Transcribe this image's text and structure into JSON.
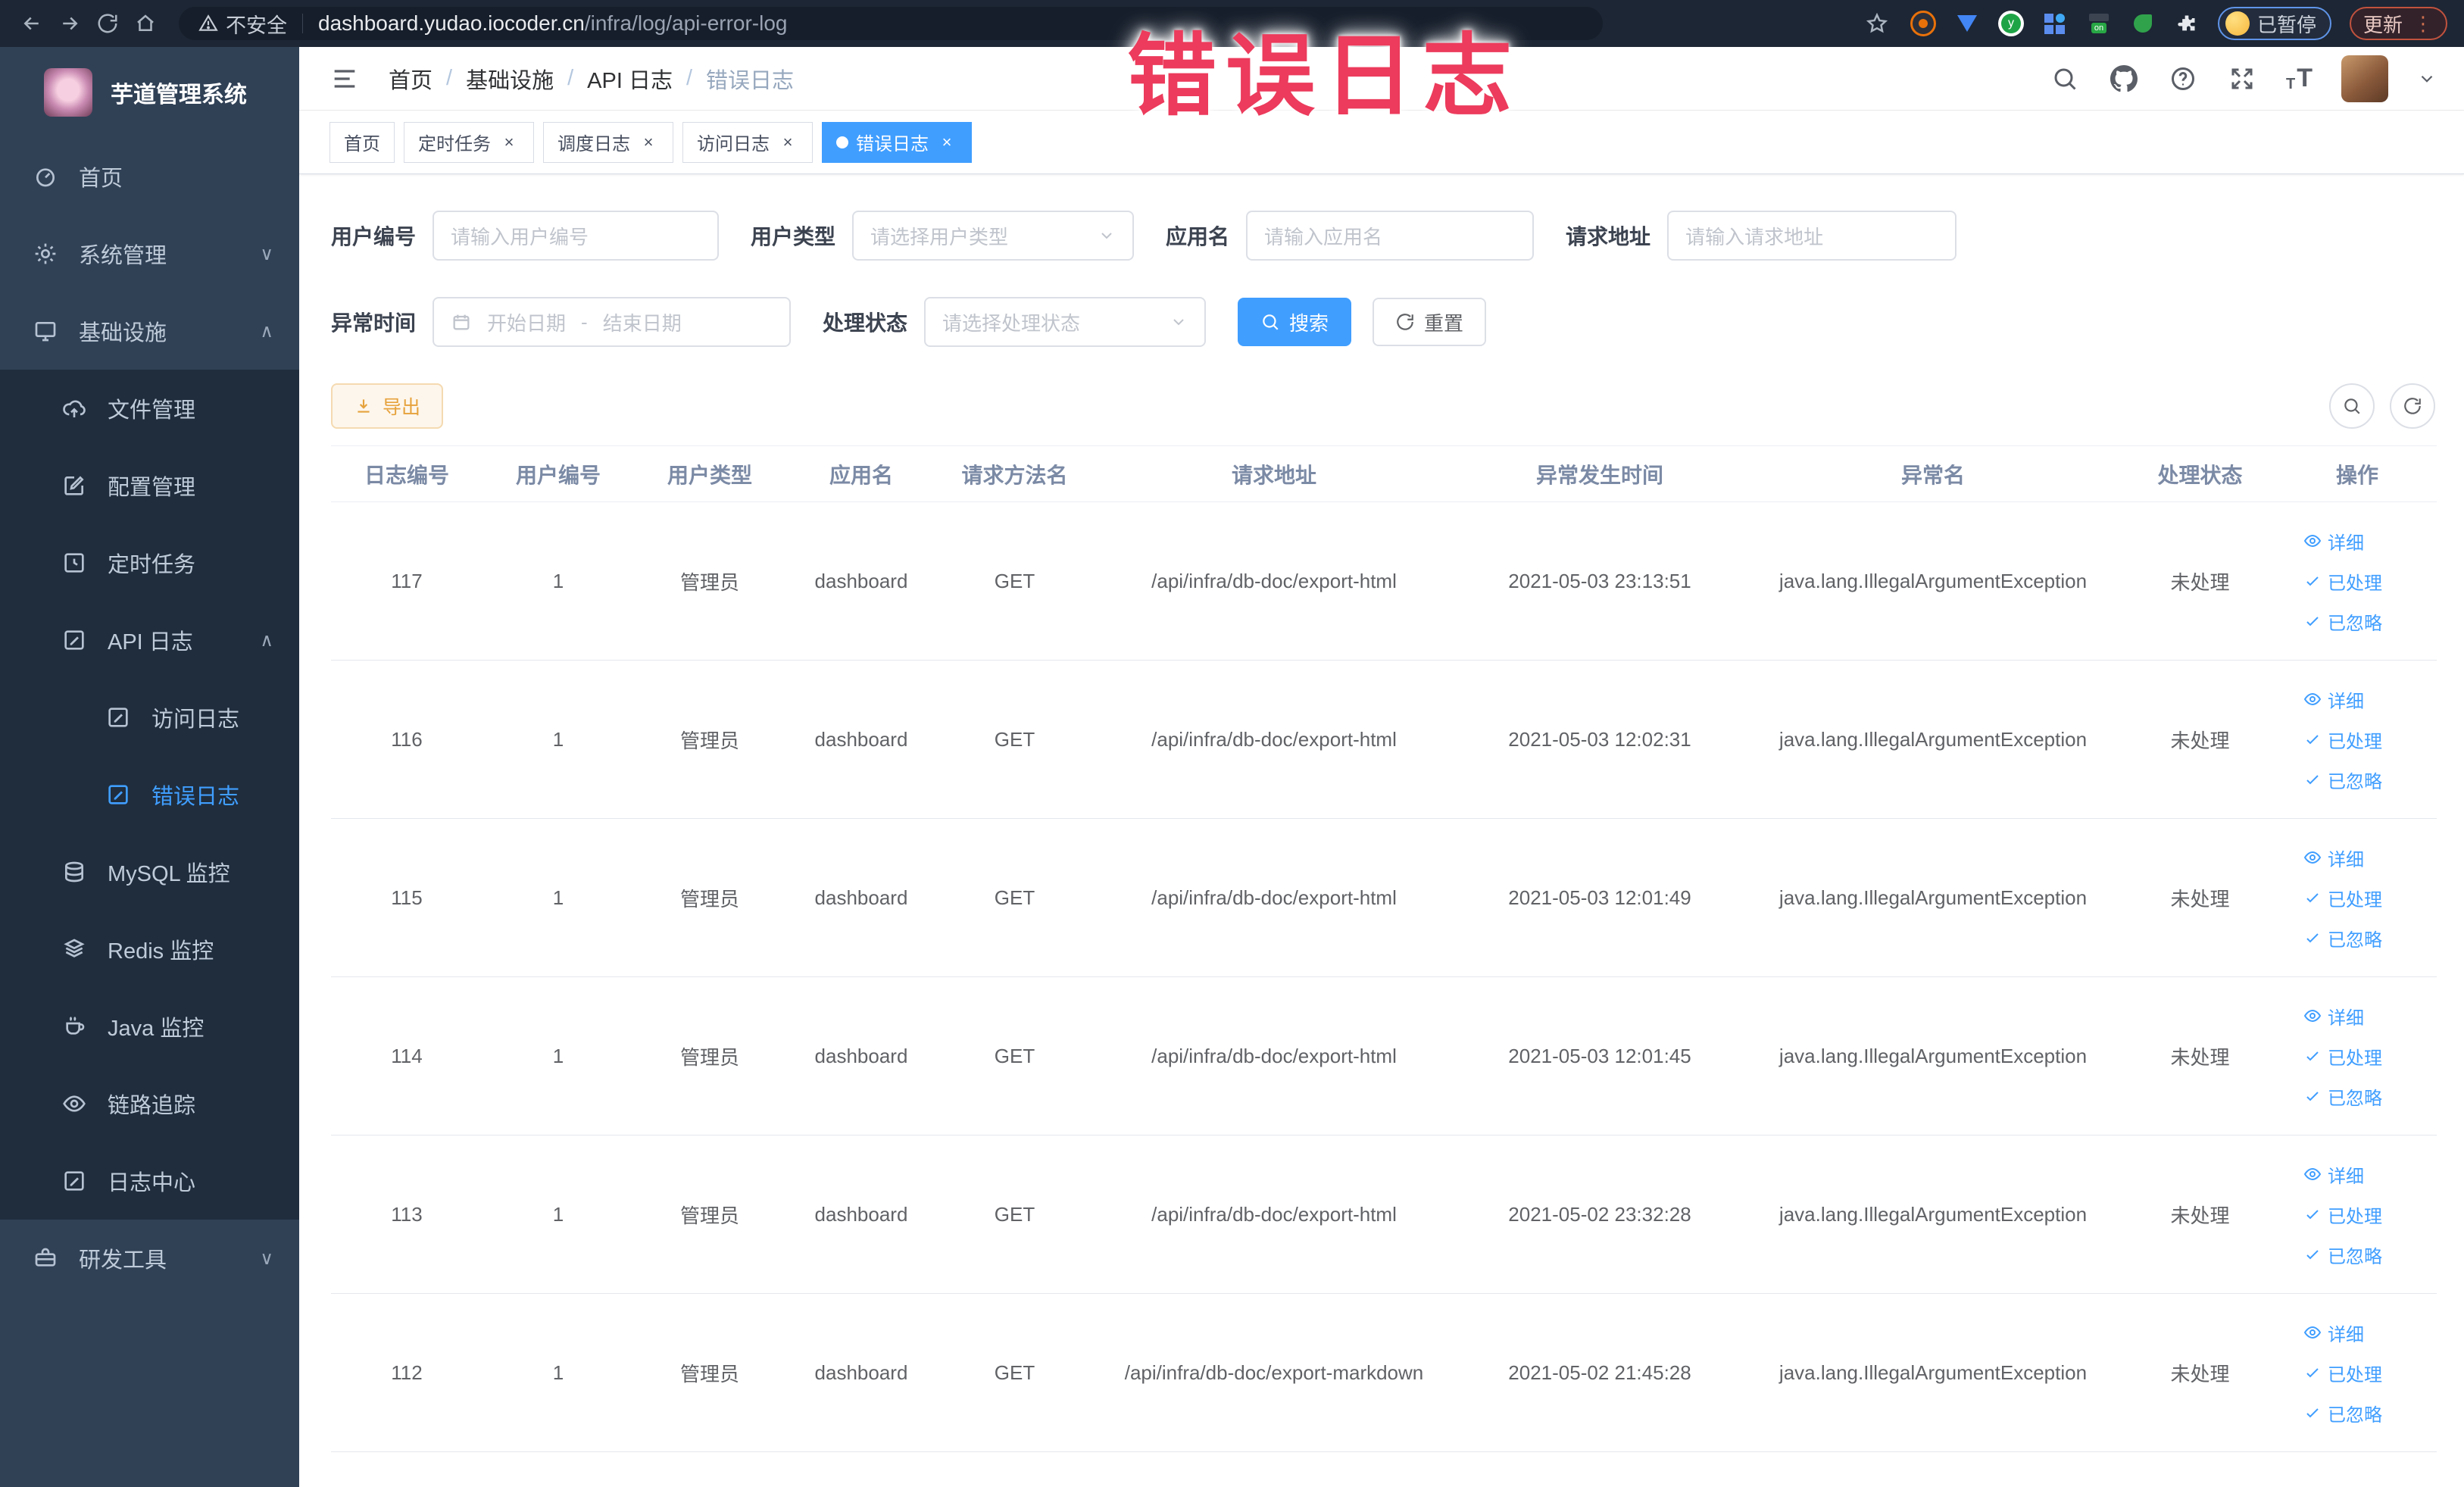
{
  "browser": {
    "security_label": "不安全",
    "url_host": "dashboard.yudao.iocoder.cn",
    "url_path": "/infra/log/api-error-log",
    "paused_badge": "已暂停",
    "update_button": "更新",
    "menu_dots": "⋮"
  },
  "annotation": {
    "text": "错误日志",
    "color": "#ec3b5c"
  },
  "sidebar": {
    "logo_title": "芋道管理系统",
    "items": [
      {
        "label": "首页",
        "icon": "dashboard",
        "level": 1,
        "arrow_glyph": ""
      },
      {
        "label": "系统管理",
        "icon": "gear",
        "level": 1,
        "arrow_glyph": "∨"
      },
      {
        "label": "基础设施",
        "icon": "monitor",
        "level": 1,
        "arrow_glyph": "∧"
      },
      {
        "label": "文件管理",
        "icon": "cloud-upload",
        "level": 2,
        "arrow_glyph": ""
      },
      {
        "label": "配置管理",
        "icon": "edit",
        "level": 2,
        "arrow_glyph": ""
      },
      {
        "label": "定时任务",
        "icon": "timer",
        "level": 2,
        "arrow_glyph": ""
      },
      {
        "label": "API 日志",
        "icon": "log",
        "level": 2,
        "arrow_glyph": "∧"
      },
      {
        "label": "访问日志",
        "icon": "log",
        "level": 3,
        "arrow_glyph": ""
      },
      {
        "label": "错误日志",
        "icon": "log",
        "level": 3,
        "arrow_glyph": "",
        "active": true
      },
      {
        "label": "MySQL 监控",
        "icon": "database",
        "level": 2,
        "arrow_glyph": ""
      },
      {
        "label": "Redis 监控",
        "icon": "layers",
        "level": 2,
        "arrow_glyph": ""
      },
      {
        "label": "Java 监控",
        "icon": "coffee",
        "level": 2,
        "arrow_glyph": ""
      },
      {
        "label": "链路追踪",
        "icon": "eye",
        "level": 2,
        "arrow_glyph": ""
      },
      {
        "label": "日志中心",
        "icon": "log",
        "level": 2,
        "arrow_glyph": ""
      },
      {
        "label": "研发工具",
        "icon": "toolbox",
        "level": 1,
        "arrow_glyph": "∨"
      }
    ]
  },
  "breadcrumb": {
    "items": [
      "首页",
      "基础设施",
      "API 日志"
    ],
    "current": "错误日志",
    "separator": "/"
  },
  "tabs": [
    {
      "label": "首页",
      "closable": false
    },
    {
      "label": "定时任务",
      "closable": true
    },
    {
      "label": "调度日志",
      "closable": true
    },
    {
      "label": "访问日志",
      "closable": true
    },
    {
      "label": "错误日志",
      "closable": true,
      "active": true
    }
  ],
  "tab_close_glyph": "×",
  "filters": {
    "user_id": {
      "label": "用户编号",
      "placeholder": "请输入用户编号"
    },
    "user_type": {
      "label": "用户类型",
      "placeholder": "请选择用户类型"
    },
    "app_name": {
      "label": "应用名",
      "placeholder": "请输入应用名"
    },
    "request_url": {
      "label": "请求地址",
      "placeholder": "请输入请求地址"
    },
    "exception_time": {
      "label": "异常时间",
      "start_placeholder": "开始日期",
      "separator": "-",
      "end_placeholder": "结束日期"
    },
    "process_status": {
      "label": "处理状态",
      "placeholder": "请选择处理状态"
    },
    "search_button": "搜索",
    "reset_button": "重置"
  },
  "toolbar": {
    "export_button": "导出"
  },
  "table": {
    "columns": [
      "日志编号",
      "用户编号",
      "用户类型",
      "应用名",
      "请求方法名",
      "请求地址",
      "异常发生时间",
      "异常名",
      "处理状态",
      "操作"
    ],
    "row_actions": [
      "详细",
      "已处理",
      "已忽略"
    ],
    "rows": [
      {
        "id": "117",
        "user_id": "1",
        "user_type": "管理员",
        "app_name": "dashboard",
        "method": "GET",
        "url": "/api/infra/db-doc/export-html",
        "time": "2021-05-03 23:13:51",
        "exception": "java.lang.IllegalArgumentException",
        "status": "未处理"
      },
      {
        "id": "116",
        "user_id": "1",
        "user_type": "管理员",
        "app_name": "dashboard",
        "method": "GET",
        "url": "/api/infra/db-doc/export-html",
        "time": "2021-05-03 12:02:31",
        "exception": "java.lang.IllegalArgumentException",
        "status": "未处理"
      },
      {
        "id": "115",
        "user_id": "1",
        "user_type": "管理员",
        "app_name": "dashboard",
        "method": "GET",
        "url": "/api/infra/db-doc/export-html",
        "time": "2021-05-03 12:01:49",
        "exception": "java.lang.IllegalArgumentException",
        "status": "未处理"
      },
      {
        "id": "114",
        "user_id": "1",
        "user_type": "管理员",
        "app_name": "dashboard",
        "method": "GET",
        "url": "/api/infra/db-doc/export-html",
        "time": "2021-05-03 12:01:45",
        "exception": "java.lang.IllegalArgumentException",
        "status": "未处理"
      },
      {
        "id": "113",
        "user_id": "1",
        "user_type": "管理员",
        "app_name": "dashboard",
        "method": "GET",
        "url": "/api/infra/db-doc/export-html",
        "time": "2021-05-02 23:32:28",
        "exception": "java.lang.IllegalArgumentException",
        "status": "未处理"
      },
      {
        "id": "112",
        "user_id": "1",
        "user_type": "管理员",
        "app_name": "dashboard",
        "method": "GET",
        "url": "/api/infra/db-doc/export-markdown",
        "time": "2021-05-02 21:45:28",
        "exception": "java.lang.IllegalArgumentException",
        "status": "未处理"
      }
    ]
  },
  "colors": {
    "accent": "#409eff",
    "sidebar_bg": "#304156",
    "sidebar_submenu_bg": "#1f2d3d",
    "browser_bar_bg": "#1d2634",
    "export_text": "#e6a23c",
    "export_bg": "#fdf6ec",
    "annotation_red": "#ec3b5c"
  }
}
